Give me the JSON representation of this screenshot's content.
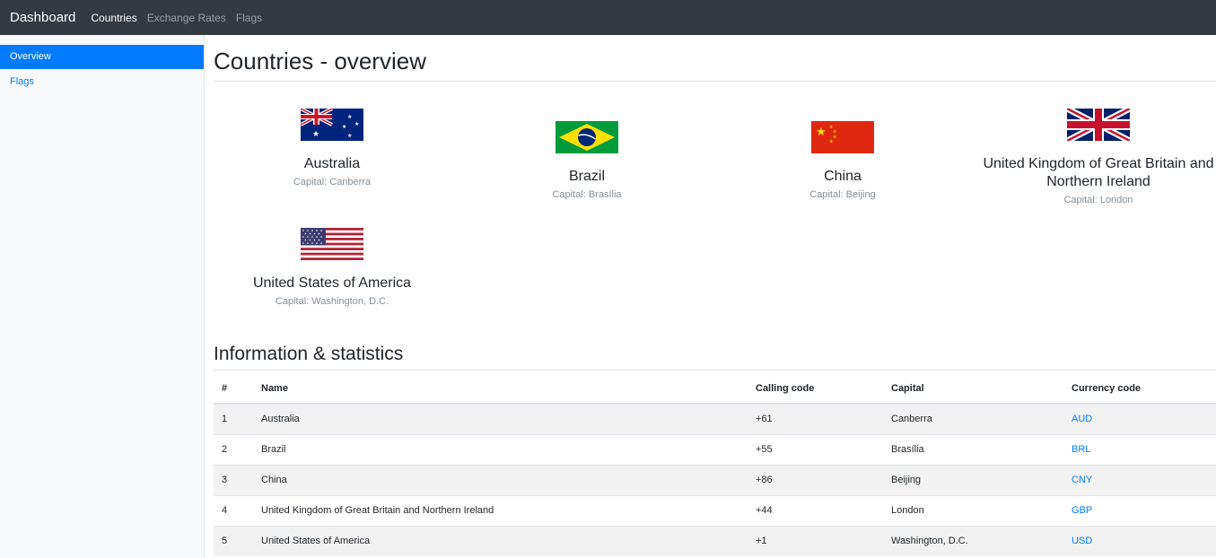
{
  "navbar": {
    "brand": "Dashboard",
    "links": [
      {
        "label": "Countries",
        "active": true
      },
      {
        "label": "Exchange Rates",
        "active": false
      },
      {
        "label": "Flags",
        "active": false
      }
    ]
  },
  "sidebar": {
    "items": [
      {
        "label": "Overview",
        "active": true
      },
      {
        "label": "Flags",
        "active": false
      }
    ]
  },
  "page": {
    "title": "Countries - overview",
    "section_title": "Information & statistics"
  },
  "countries": [
    {
      "name": "Australia",
      "capital": "Capital: Canberra",
      "flag": "australia-flag-icon"
    },
    {
      "name": "Brazil",
      "capital": "Capital: Brasília",
      "flag": "brazil-flag-icon"
    },
    {
      "name": "China",
      "capital": "Capital: Beijing",
      "flag": "china-flag-icon"
    },
    {
      "name": "United Kingdom of Great Britain and Northern Ireland",
      "capital": "Capital: London",
      "flag": "uk-flag-icon"
    },
    {
      "name": "United States of America",
      "capital": "Capital: Washington, D.C.",
      "flag": "usa-flag-icon"
    }
  ],
  "table": {
    "headers": [
      "#",
      "Name",
      "Calling code",
      "Capital",
      "Currency code"
    ],
    "rows": [
      [
        "1",
        "Australia",
        "+61",
        "Canberra",
        "AUD"
      ],
      [
        "2",
        "Brazil",
        "+55",
        "Brasília",
        "BRL"
      ],
      [
        "3",
        "China",
        "+86",
        "Beijing",
        "CNY"
      ],
      [
        "4",
        "United Kingdom of Great Britain and Northern Ireland",
        "+44",
        "London",
        "GBP"
      ],
      [
        "5",
        "United States of America",
        "+1",
        "Washington, D.C.",
        "USD"
      ]
    ]
  },
  "colors": {
    "navbar_bg": "#343a40",
    "accent": "#007bff",
    "muted": "#868e96"
  }
}
